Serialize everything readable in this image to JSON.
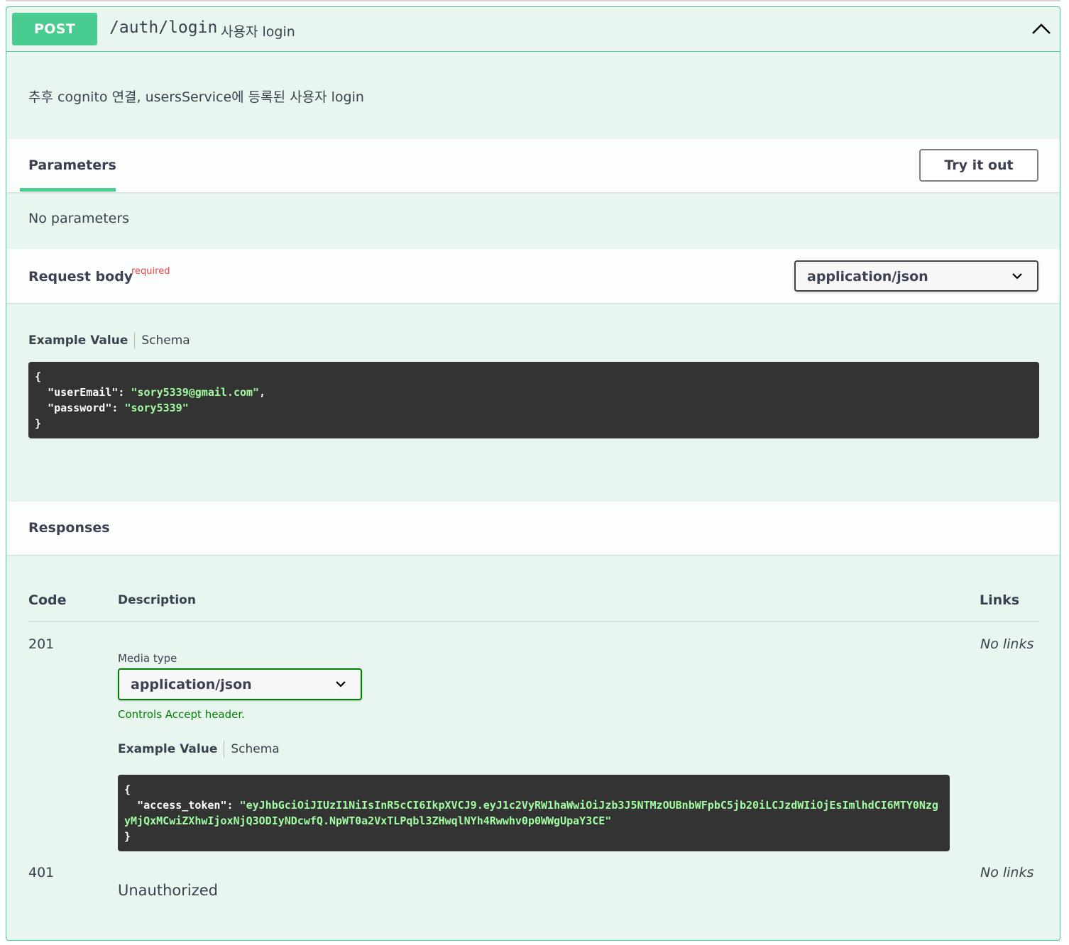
{
  "operation": {
    "method": "POST",
    "path": "/auth/login",
    "summary": "사용자 login",
    "description": "추후 cognito 연결, usersService에 등록된 사용자 login"
  },
  "parameters": {
    "tab_label": "Parameters",
    "try_button": "Try it out",
    "empty_text": "No parameters"
  },
  "request_body": {
    "title": "Request body",
    "required_label": "required",
    "content_type": "application/json",
    "example_tab": "Example Value",
    "schema_tab": "Schema",
    "example": {
      "open": "{",
      "k1": "\"userEmail\"",
      "v1": "\"sory5339@gmail.com\"",
      "k2": "\"password\"",
      "v2": "\"sory5339\"",
      "close": "}"
    }
  },
  "responses": {
    "title": "Responses",
    "col_code": "Code",
    "col_description": "Description",
    "col_links": "Links",
    "items": [
      {
        "code": "201",
        "links": "No links",
        "media_type_label": "Media type",
        "media_type": "application/json",
        "accept_note": "Controls Accept header.",
        "example_tab": "Example Value",
        "schema_tab": "Schema",
        "example": {
          "open": "{",
          "k1": "\"access_token\"",
          "v1": "\"eyJhbGciOiJIUzI1NiIsInR5cCI6IkpXVCJ9.eyJ1c2VyRW1haWwiOiJzb3J5NTMzOUBnbWFpbC5jb20iLCJzdWIiOjEsImlhdCI6MTY0NzgyMjQxMCwiZXhwIjoxNjQ3ODIyNDcwfQ.NpWT0a2VxTLPqbl3ZHwqlNYh4Rwwhv0p0WWgUpaY3CE\"",
          "close": "}"
        }
      },
      {
        "code": "401",
        "links": "No links",
        "description": "Unauthorized"
      }
    ]
  },
  "colors": {
    "post_accent": "#49cc90",
    "post_bg": "#e8f6ef",
    "code_bg": "#333333",
    "code_string": "#a2fca2",
    "required": "#e94545",
    "accept_note": "#008000"
  }
}
